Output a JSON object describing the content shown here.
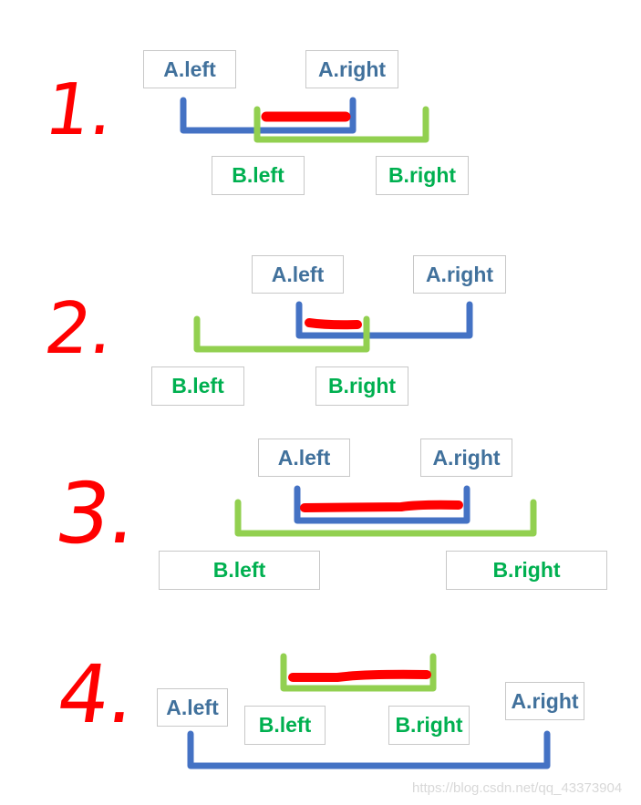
{
  "colors": {
    "interval_a": "#4472C4",
    "interval_b": "#92D050",
    "overlap": "#FF0000",
    "label_a": "#41719C",
    "label_b": "#00B050"
  },
  "cases": [
    {
      "number": "1.",
      "a_left": "A.left",
      "a_right": "A.right",
      "b_left": "B.left",
      "b_right": "B.right"
    },
    {
      "number": "2.",
      "a_left": "A.left",
      "a_right": "A.right",
      "b_left": "B.left",
      "b_right": "B.right"
    },
    {
      "number": "3.",
      "a_left": "A.left",
      "a_right": "A.right",
      "b_left": "B.left",
      "b_right": "B.right"
    },
    {
      "number": "4.",
      "a_left": "A.left",
      "a_right": "A.right",
      "b_left": "B.left",
      "b_right": "B.right"
    }
  ],
  "watermark": "https://blog.csdn.net/qq_43373904"
}
